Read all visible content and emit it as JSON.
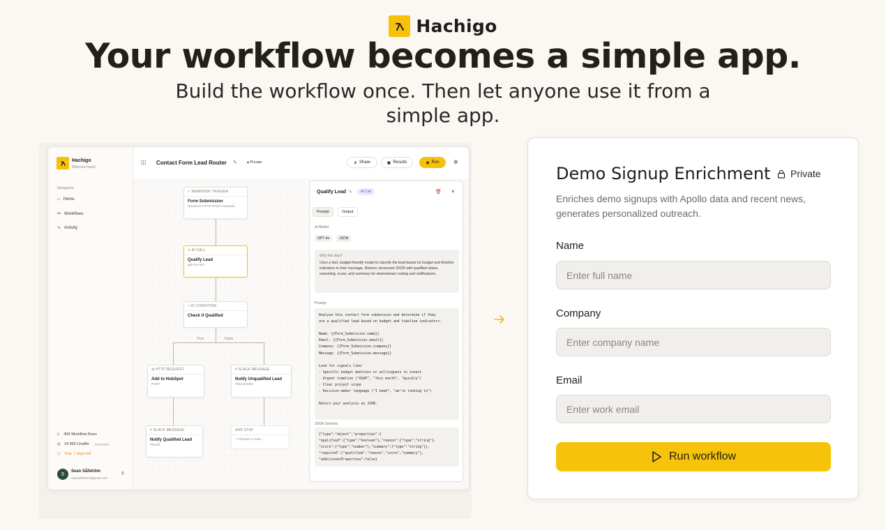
{
  "brand": {
    "name": "Hachigo"
  },
  "hero": {
    "headline": "Your workflow becomes a simple app.",
    "subline": "Build the workflow once. Then let anyone use it from a simple app."
  },
  "app": {
    "sidebar": {
      "app_name": "Hachigo",
      "welcome": "Welcome back!",
      "nav_label": "Navigation",
      "items": [
        "Home",
        "Workflows",
        "Activity"
      ],
      "runs": "499 Workflow Runs",
      "credits": "14 999 Credits",
      "plan": "STARTER",
      "trial": "Trial: 7 days left",
      "user_initial": "S",
      "user_name": "Sean Såfström",
      "user_email": "seansafstrom@gmail.com"
    },
    "topbar": {
      "title": "Contact Form Lead Router",
      "visibility": "Private",
      "share": "Share",
      "results": "Results",
      "run": "Run"
    },
    "nodes": {
      "webhook": {
        "type": "WEBHOOK TRIGGER",
        "title": "Form Submission",
        "sub": "Receives HTTP POST requests"
      },
      "ai": {
        "type": "AI CALL",
        "title": "Qualify Lead",
        "sub": "gpt-4o-mini"
      },
      "cond": {
        "type": "IF CONDITION",
        "title": "Check if Qualified"
      },
      "true_label": "True",
      "false_label": "False",
      "http": {
        "type": "HTTP REQUEST",
        "title": "Add to HubSpot",
        "sub": "POST"
      },
      "slack1": {
        "type": "SLACK MESSAGE",
        "title": "Notify Unqualified Lead",
        "sub": "#low-priority"
      },
      "slack2": {
        "type": "SLACK MESSAGE",
        "title": "Notify Qualified Lead",
        "sub": "#leads"
      },
      "add": {
        "type": "ADD STEP",
        "sub": "+ Choose a node..."
      }
    },
    "panel": {
      "title": "Qualify Lead",
      "badge": "AI Call",
      "tabs": [
        "Prompt",
        "Output"
      ],
      "model_label": "AI Model",
      "model_chips": [
        "GPT-4o",
        "JSON"
      ],
      "why_title": "Why this step?",
      "why_body": "Uses a fast, budget-friendly model to classify the lead based on budget and timeline indicators in their message. Returns structured JSON with qualified status, reasoning, score, and summary for downstream routing and notifications.",
      "prompt_label": "Prompt",
      "prompt": "Analyze this contact form submission and determine if they\nare a qualified lead based on budget and timeline indicators.\n\nName: {{Form_Submission.name}}\nEmail: {{Form_Submission.email}}\nCompany: {{Form_Submission.company}}\nMessage: {{Form_Submission.message}}\n\nLook for signals like:\n- Specific budget mentions or willingness to invest\n- Urgent timeline (\"ASAP\", \"this month\", \"quickly\")\n- Clear project scope\n- Decision-maker language (\"I need\", \"we're looking to\")\n\nReturn your analysis as JSON.",
      "schema_label": "JSON Schema",
      "schema": "{\"type\":\"object\",\"properties\":{\n\"qualified\":{\"type\":\"boolean\"},\"reason\":{\"type\":\"string\"},\n\"score\":{\"type\":\"number\"},\"summary\":{\"type\":\"string\"}},\n\"required\":[\"qualified\",\"reason\",\"score\",\"summary\"],\n\"additionalProperties\":false}"
    }
  },
  "form": {
    "title": "Demo Signup Enrichment",
    "visibility": "Private",
    "description": "Enriches demo signups with Apollo data and recent news, generates personalized outreach.",
    "fields": [
      {
        "label": "Name",
        "placeholder": "Enter full name"
      },
      {
        "label": "Company",
        "placeholder": "Enter company name"
      },
      {
        "label": "Email",
        "placeholder": "Enter work email"
      }
    ],
    "run_label": "Run workflow"
  },
  "colors": {
    "accent": "#f6c10b",
    "background": "#fbf8f4"
  }
}
